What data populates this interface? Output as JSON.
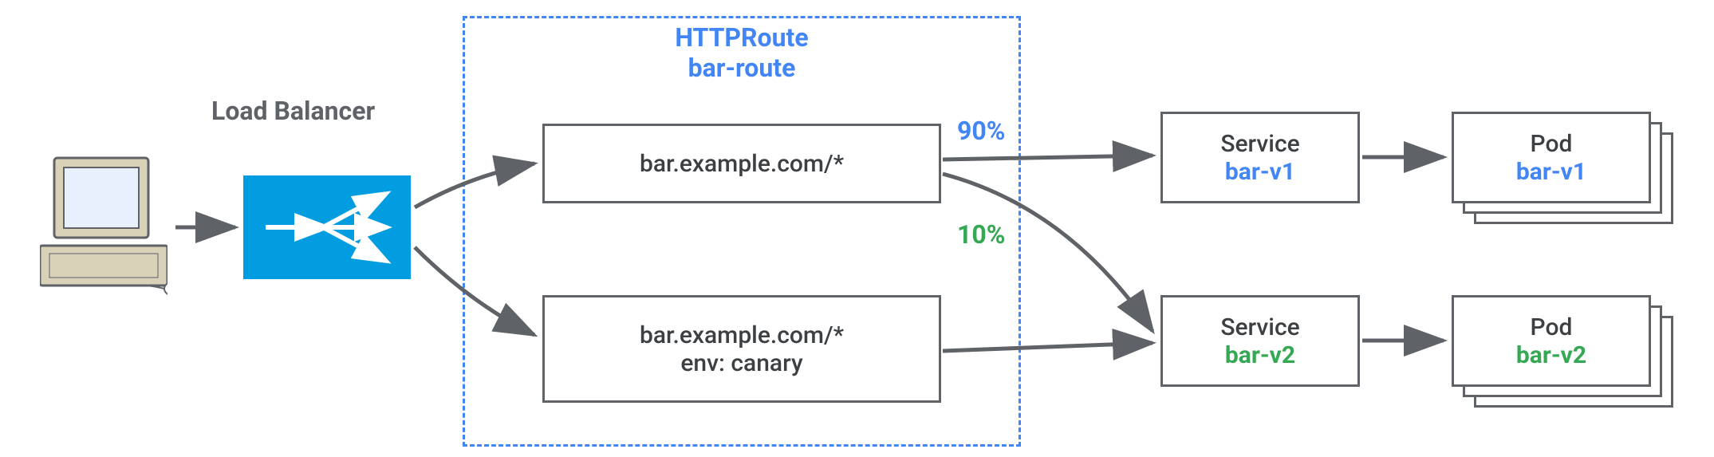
{
  "loadBalancer": {
    "title": "Load Balancer"
  },
  "httpRoute": {
    "title": "HTTPRoute",
    "name": "bar-route"
  },
  "rules": [
    {
      "match": "bar.example.com/*",
      "env": ""
    },
    {
      "match": "bar.example.com/*",
      "env": "env: canary"
    }
  ],
  "weights": {
    "v1": "90%",
    "v2": "10%"
  },
  "services": [
    {
      "label": "Service",
      "name": "bar-v1"
    },
    {
      "label": "Service",
      "name": "bar-v2"
    }
  ],
  "pods": [
    {
      "label": "Pod",
      "name": "bar-v1"
    },
    {
      "label": "Pod",
      "name": "bar-v2"
    }
  ],
  "colors": {
    "blue": "#4285f4",
    "green": "#34a853",
    "grey": "#5f6368"
  }
}
